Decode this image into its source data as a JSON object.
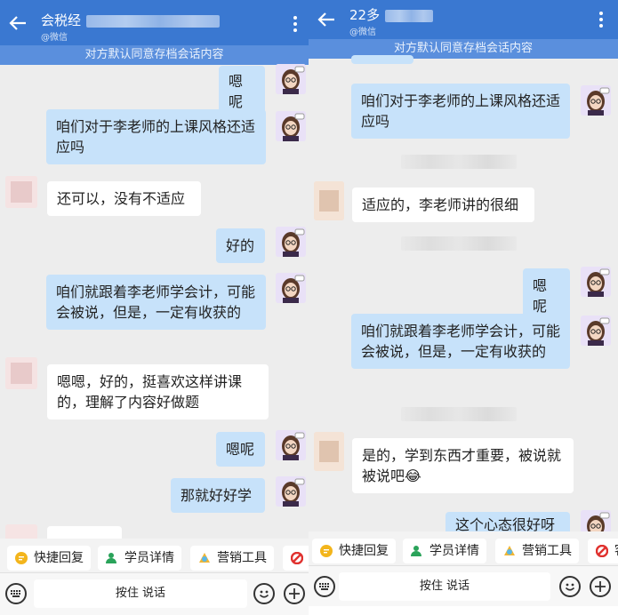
{
  "left": {
    "header": {
      "title": "会税经",
      "subtitle": "@微信"
    },
    "notice": "对方默认同意存档会话内容",
    "messages": [
      {
        "text": "嗯呢"
      },
      {
        "text": "咱们对于李老师的上课风格还适应吗"
      },
      {
        "text": "还可以，没有不适应"
      },
      {
        "text": "好的"
      },
      {
        "text": "咱们就跟着李老师学会计，可能会被说，但是，一定有收获的"
      },
      {
        "text": "嗯嗯，好的，挺喜欢这样讲课的，理解了内容好做题"
      },
      {
        "text": "嗯呢"
      },
      {
        "text": "那就好好学"
      }
    ],
    "quick_actions": [
      "快捷回复",
      "学员详情",
      "营销工具"
    ],
    "hold_to_talk": "按住 说话"
  },
  "right": {
    "header": {
      "title": "22多",
      "subtitle": "@微信"
    },
    "notice": "对方默认同意存档会话内容",
    "messages": [
      {
        "text": "咱们对于李老师的上课风格还适应吗"
      },
      {
        "text": "适应的，李老师讲的很细"
      },
      {
        "text": "嗯呢"
      },
      {
        "text": "咱们就跟着李老师学会计，可能会被说，但是，一定有收获的"
      },
      {
        "text": "是的，学到东西才重要，被说就被说吧😂"
      },
      {
        "text": "这个心态很好呀"
      }
    ],
    "quick_actions": [
      "快捷回复",
      "学员详情",
      "营销工具",
      "客"
    ],
    "hold_to_talk": "按住 说话"
  },
  "colors": {
    "header": "#3a78d1",
    "my_bubble": "#c7e2fa",
    "other_bubble": "#ffffff",
    "chat_bg": "#ededed"
  },
  "icons": [
    "back-arrow-icon",
    "more-vertical-icon",
    "keyboard-icon",
    "emoji-icon",
    "plus-icon",
    "quick-reply-icon",
    "student-icon",
    "marketing-icon"
  ]
}
